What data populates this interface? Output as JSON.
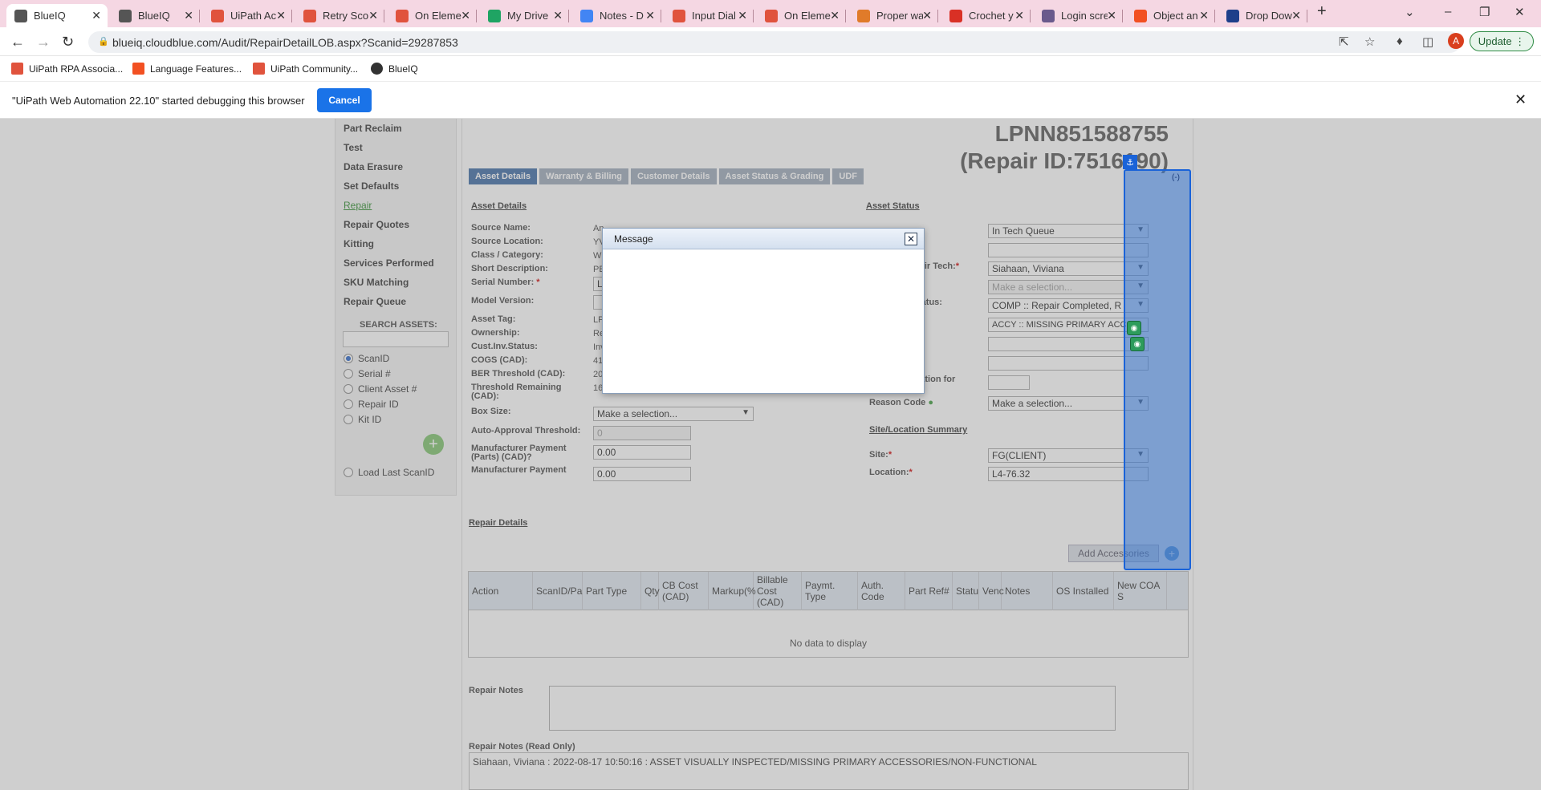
{
  "browser": {
    "tabs": [
      {
        "label": "BlueIQ",
        "icon": "globe-icon",
        "color": "#555555",
        "active": true
      },
      {
        "label": "BlueIQ",
        "icon": "globe-icon",
        "color": "#555555"
      },
      {
        "label": "UiPath Ac",
        "icon": "uipath-icon",
        "color": "#e0533d"
      },
      {
        "label": "Retry Scop",
        "icon": "uipath-icon",
        "color": "#e0533d"
      },
      {
        "label": "On Eleme",
        "icon": "uipath-icon",
        "color": "#e0533d"
      },
      {
        "label": "My Drive",
        "icon": "drive-icon",
        "color": "#1fa463"
      },
      {
        "label": "Notes - D",
        "icon": "docs-icon",
        "color": "#4285f4"
      },
      {
        "label": "Input Dial",
        "icon": "uipath-icon",
        "color": "#e0533d"
      },
      {
        "label": "On Eleme",
        "icon": "uipath-icon",
        "color": "#e0533d"
      },
      {
        "label": "Proper wa",
        "icon": "java-icon",
        "color": "#e07b2a"
      },
      {
        "label": "Crochet y",
        "icon": "gmail-icon",
        "color": "#d93025"
      },
      {
        "label": "Login scre",
        "icon": "plex-icon",
        "color": "#6a5a8c"
      },
      {
        "label": "Object an",
        "icon": "microsoft-icon",
        "color": "#f25022"
      },
      {
        "label": "Drop Dow",
        "icon": "bookmark-icon",
        "color": "#1e3f8a"
      }
    ],
    "url": "blueiq.cloudblue.com/Audit/RepairDetailLOB.aspx?Scanid=29287853",
    "update_label": "Update",
    "profile_initial": "A",
    "bookmarks": [
      {
        "label": "UiPath RPA Associa...",
        "icon": "uipath-icon"
      },
      {
        "label": "Language Features...",
        "icon": "microsoft-icon"
      },
      {
        "label": "UiPath Community...",
        "icon": "uipath-icon"
      },
      {
        "label": "BlueIQ",
        "icon": "globe-icon"
      }
    ],
    "debug_text": "\"UiPath Web Automation 22.10\" started debugging this browser",
    "cancel_label": "Cancel"
  },
  "nav": {
    "items": [
      "Part Reclaim",
      "Test",
      "Data Erasure",
      "Set Defaults",
      "Repair",
      "Repair Quotes",
      "Kitting",
      "Services Performed",
      "SKU Matching",
      "Repair Queue"
    ],
    "current": "Repair",
    "search_label": "SEARCH ASSETS:",
    "radios": [
      "ScanID",
      "Serial #",
      "Client Asset #",
      "Repair ID",
      "Kit ID"
    ],
    "load_last": "Load Last ScanID"
  },
  "header": {
    "lpn": "LPNN851588755",
    "repair_id": "(Repair ID:7516190)"
  },
  "tabs": [
    "Asset Details",
    "Warranty & Billing",
    "Customer Details",
    "Asset Status & Grading",
    "UDF"
  ],
  "asset_details": {
    "heading": "Asset Details",
    "fields": [
      {
        "label": "Source Name:",
        "value": "An"
      },
      {
        "label": "Source Location:",
        "value": "YV"
      },
      {
        "label": "Class / Category:",
        "value": "Wi"
      },
      {
        "label": "Short Description:",
        "value": "PE"
      },
      {
        "label": "Serial Number:",
        "value": "LI",
        "required": true
      },
      {
        "label": "Model Version:",
        "value": ""
      },
      {
        "label": "Asset Tag:",
        "value": "LP"
      },
      {
        "label": "Ownership:",
        "value": "Re"
      },
      {
        "label": "Cust.Inv.Status:",
        "value": "Inv"
      },
      {
        "label": "COGS (CAD):",
        "value": "41"
      },
      {
        "label": "BER Threshold (CAD):",
        "value": "20"
      },
      {
        "label": "Threshold Remaining (CAD):",
        "value": "16"
      }
    ],
    "box_size_label": "Box Size:",
    "box_size_value": "Make a selection...",
    "auto_approval_label": "Auto-Approval Threshold:",
    "auto_approval_value": "0",
    "mfr_parts_label": "Manufacturer Payment (Parts) (CAD)?",
    "mfr_parts_value": "0.00",
    "mfr_label": "Manufacturer Payment",
    "mfr_value": "0.00"
  },
  "asset_status": {
    "heading": "Asset Status",
    "status_value": "In Tech Queue",
    "tech_label": "pair Tech:",
    "tech_value": "Siahaan, Viviana",
    "sel3_value": "Make a selection...",
    "status2_label": "tatus:",
    "status2_value": "COMP :: Repair Completed, R",
    "reason_value": "ACCY :: MISSING PRIMARY ACC",
    "duration_label": "ration for",
    "reason_code_label": "Reason Code",
    "reason_code_value": "Make a selection...",
    "site_heading": "Site/Location Summary",
    "site_label": "Site:",
    "site_value": "FG(CLIENT)",
    "location_label": "Location:",
    "location_value": "L4-76.32"
  },
  "repair": {
    "heading": "Repair Details",
    "add_accessories": "Add Accessories",
    "columns": [
      "Action",
      "ScanID/Pa",
      "Part Type",
      "Qty",
      "CB Cost (CAD)",
      "Markup(%",
      "Billable Cost (CAD)",
      "Paymt. Type",
      "Auth. Code",
      "Part Ref#",
      "Statu",
      "Venc",
      "Notes",
      "OS Installed",
      "New COA S"
    ],
    "no_data": "No data to display",
    "notes_label": "Repair Notes",
    "notes_ro_label": "Repair Notes (Read Only)",
    "notes_ro_text": "Siahaan, Viviana : 2022-08-17 10:50:16 : ASSET VISUALLY INSPECTED/MISSING PRIMARY ACCESSORIES/NON-FUNCTIONAL",
    "selector_label": "(-)"
  },
  "modal": {
    "title": "Message"
  }
}
